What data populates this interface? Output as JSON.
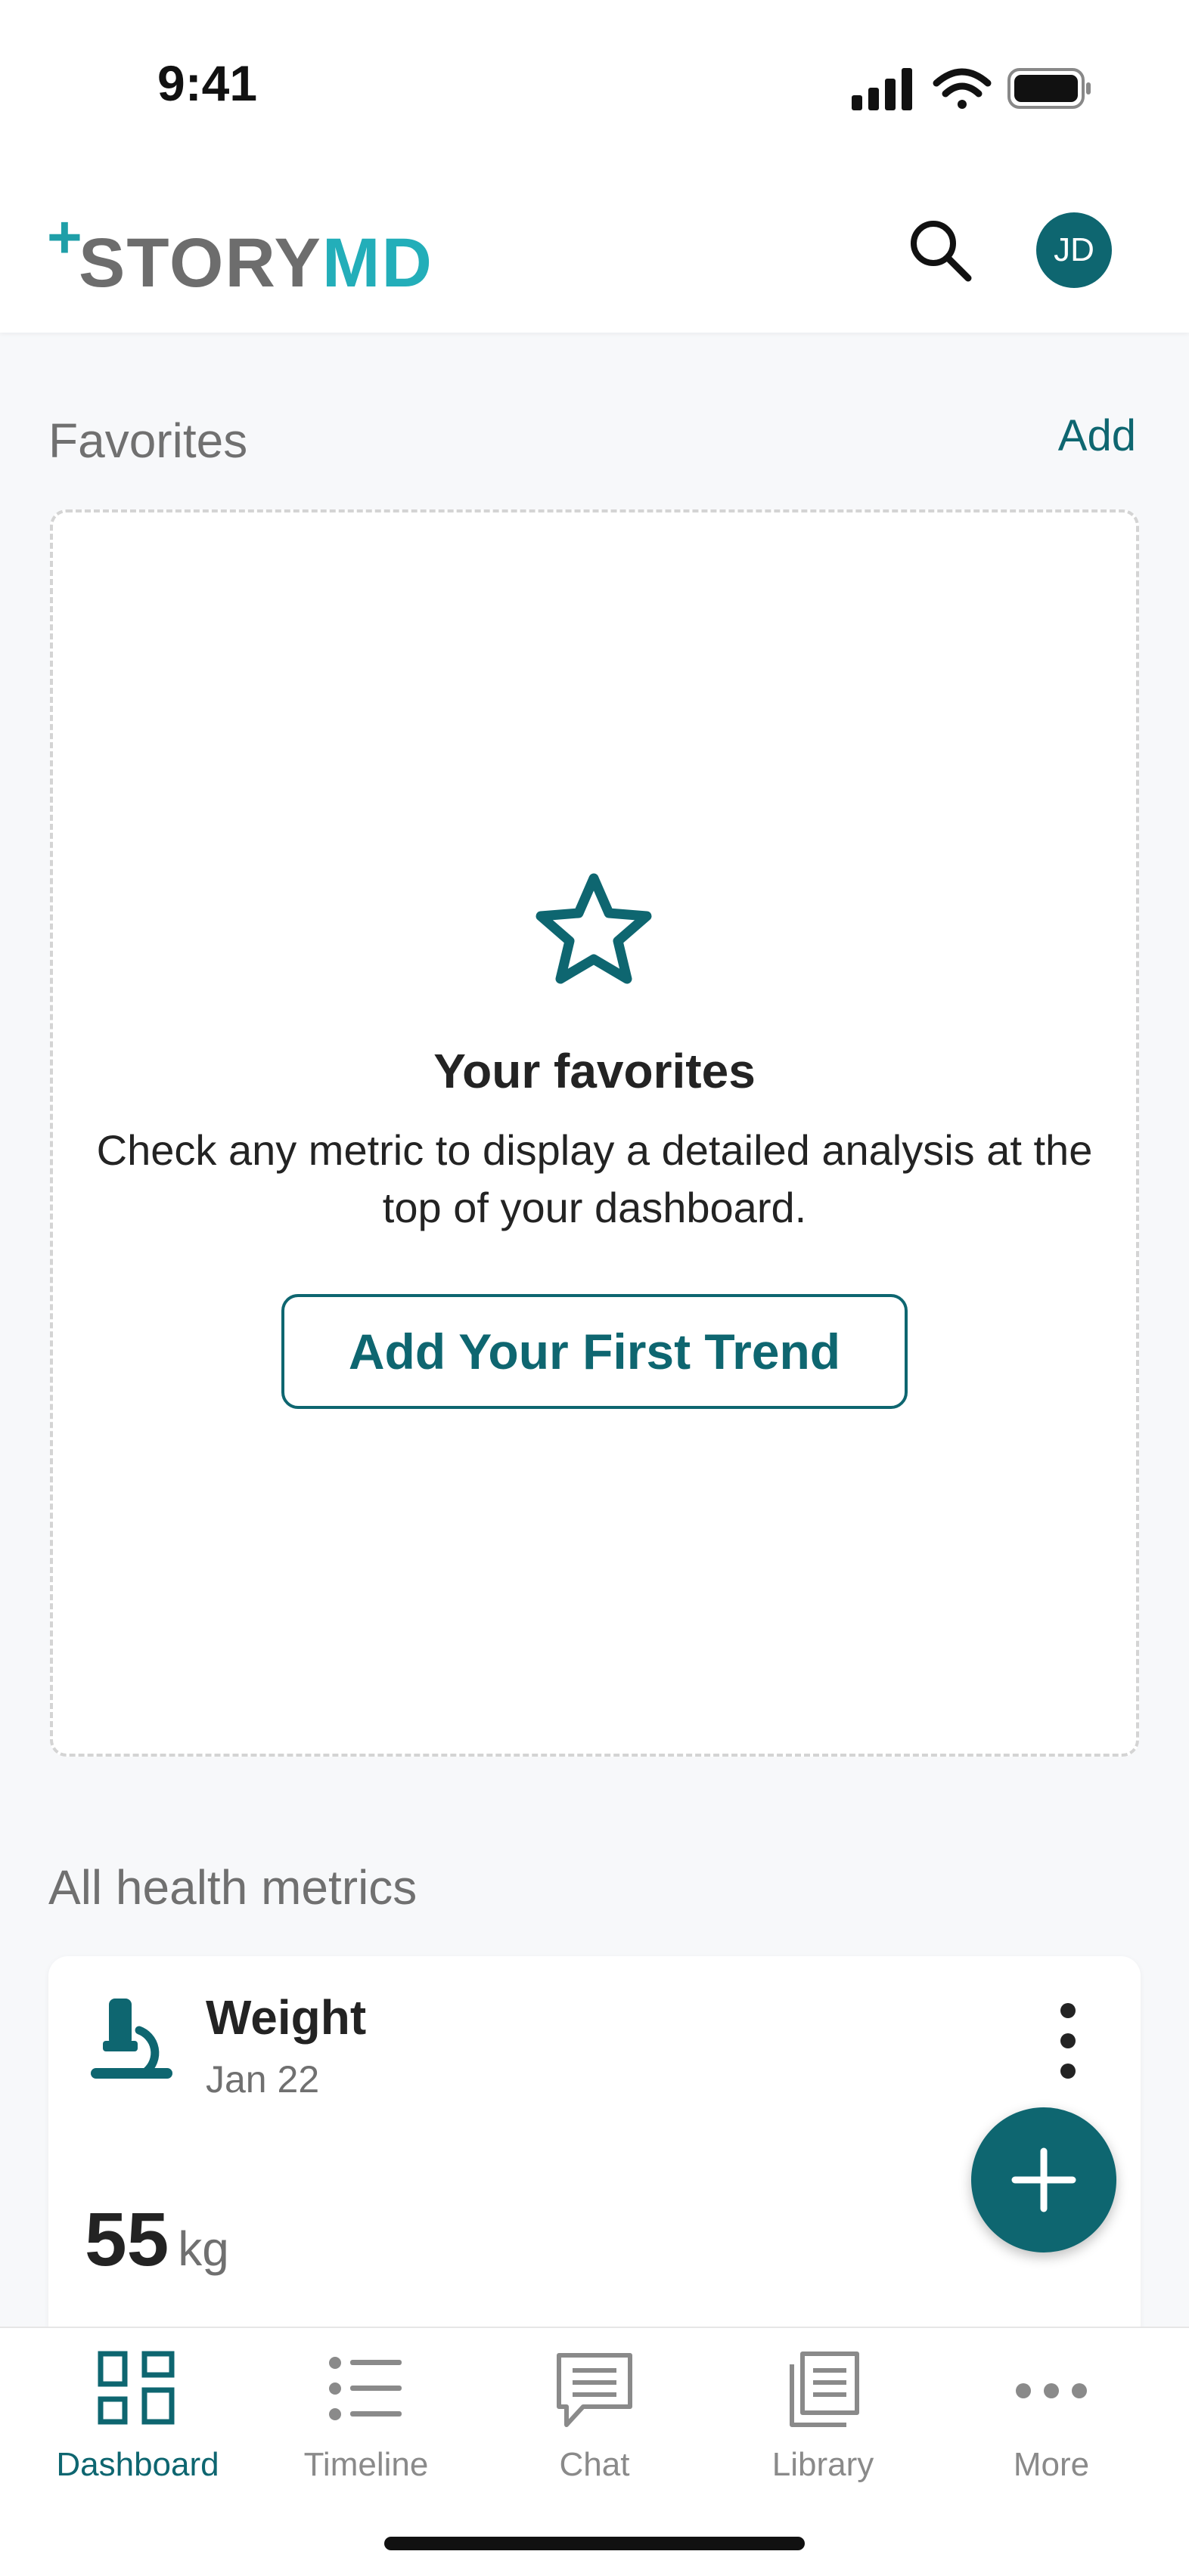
{
  "status_bar": {
    "time": "9:41"
  },
  "header": {
    "brand_plus": "+",
    "brand_story": "STORY",
    "brand_md": "MD",
    "avatar_initials": "JD"
  },
  "favorites": {
    "title": "Favorites",
    "add_label": "Add",
    "heading": "Your favorites",
    "description": "Check any metric to display a detailed analysis at the top of your dashboard.",
    "cta_label": "Add Your First Trend"
  },
  "metrics": {
    "title": "All health metrics",
    "items": [
      {
        "name": "Weight",
        "date": "Jan 22",
        "value": "55",
        "unit": "kg"
      }
    ]
  },
  "tabbar": {
    "tabs": [
      {
        "label": "Dashboard",
        "icon": "dashboard-icon",
        "active": true
      },
      {
        "label": "Timeline",
        "icon": "list-icon",
        "active": false
      },
      {
        "label": "Chat",
        "icon": "chat-icon",
        "active": false
      },
      {
        "label": "Library",
        "icon": "library-icon",
        "active": false
      },
      {
        "label": "More",
        "icon": "more-icon",
        "active": false
      }
    ]
  },
  "colors": {
    "primary": "#0e6670",
    "brand_teal": "#23aeb9",
    "brand_gray": "#6d6d6d",
    "muted_text": "#707070",
    "background": "#f7f8fa"
  }
}
